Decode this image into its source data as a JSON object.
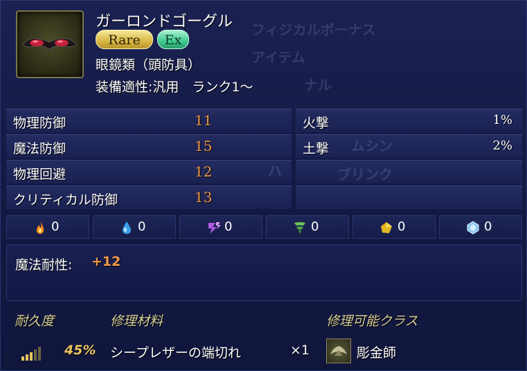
{
  "item": {
    "name": "ガーロンドゴーグル",
    "badges": {
      "rare": "Rare",
      "ex": "Ex"
    },
    "category": "眼鏡類（頭防具）",
    "equip_info": "装備適性:汎用　ランク1～",
    "icon": "goggles-icon"
  },
  "ghost_text": [
    "フィジカルボーナス",
    "アイテム",
    "ナル",
    "ハ",
    "ムシン",
    "ブリンク"
  ],
  "stats": [
    {
      "label": "物理防御",
      "value": "11"
    },
    {
      "label": "魔法防御",
      "value": "15"
    },
    {
      "label": "物理回避",
      "value": "12"
    },
    {
      "label": "クリティカル防御",
      "value": "13"
    }
  ],
  "element_stats": [
    {
      "label": "火撃",
      "value": "1%"
    },
    {
      "label": "土撃",
      "value": "2%"
    }
  ],
  "elements": [
    {
      "icon": "fire-icon",
      "value": "0"
    },
    {
      "icon": "water-icon",
      "value": "0"
    },
    {
      "icon": "lightning-icon",
      "value": "0"
    },
    {
      "icon": "wind-icon",
      "value": "0"
    },
    {
      "icon": "earth-icon",
      "value": "0"
    },
    {
      "icon": "ice-icon",
      "value": "0"
    }
  ],
  "magic_resistance": {
    "label": "魔法耐性:",
    "value": "+12"
  },
  "repair": {
    "durability_label": "耐久度",
    "material_label": "修理材料",
    "class_label": "修理可能クラス",
    "durability_value": "45%",
    "material": "シープレザーの端切れ",
    "quantity": "×1",
    "class_name": "彫金師",
    "class_icon": "goldsmith-icon"
  },
  "colors": {
    "accent": "#f09a4a",
    "background": "#141a44",
    "header_label": "#d8cf98"
  }
}
